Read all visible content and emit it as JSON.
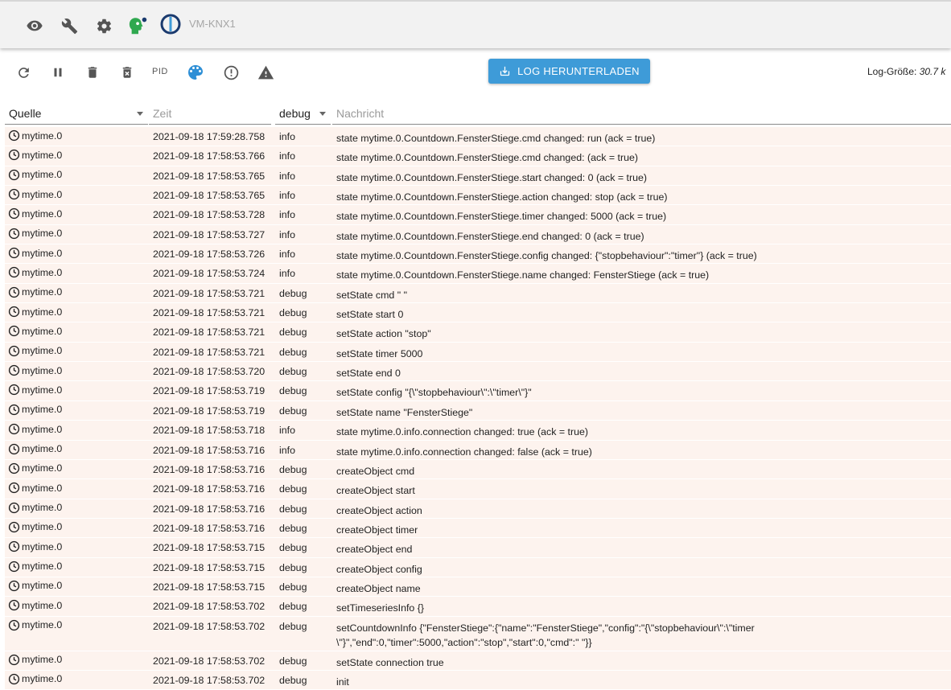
{
  "appbar": {
    "host": "VM-KNX1",
    "icons": [
      "eye-icon",
      "wrench-icon",
      "gear-icon",
      "admin-person-icon",
      "iobroker-logo-icon"
    ]
  },
  "toolbar": {
    "icons": [
      "refresh-icon",
      "pause-icon",
      "delete-icon",
      "delete-all-icon",
      "pid-label",
      "palette-icon",
      "error-circle-icon",
      "warning-triangle-icon"
    ],
    "pid_label": "PID",
    "download_label": "LOG HERUNTERLADEN",
    "logsize_label": "Log-Größe:",
    "logsize_value": "30.7 k"
  },
  "colors": {
    "accent": "#3e9bd8",
    "row_bg": "#fdf3ee",
    "admin_green": "#2fa84f",
    "admin_dot": "#1a3a6e"
  },
  "table": {
    "headers": {
      "source": "Quelle",
      "time": "Zeit",
      "severity": "debug",
      "message": "Nachricht"
    },
    "rows": [
      {
        "source": "mytime.0",
        "time": "2021-09-18 17:59:28.758",
        "severity": "info",
        "message": [
          "state mytime.0.Countdown.FensterStiege.cmd changed: run (ack = true)"
        ]
      },
      {
        "source": "mytime.0",
        "time": "2021-09-18 17:58:53.766",
        "severity": "info",
        "message": [
          "state mytime.0.Countdown.FensterStiege.cmd changed: (ack = true)"
        ]
      },
      {
        "source": "mytime.0",
        "time": "2021-09-18 17:58:53.765",
        "severity": "info",
        "message": [
          "state mytime.0.Countdown.FensterStiege.start changed: 0 (ack = true)"
        ]
      },
      {
        "source": "mytime.0",
        "time": "2021-09-18 17:58:53.765",
        "severity": "info",
        "message": [
          "state mytime.0.Countdown.FensterStiege.action changed: stop (ack = true)"
        ]
      },
      {
        "source": "mytime.0",
        "time": "2021-09-18 17:58:53.728",
        "severity": "info",
        "message": [
          "state mytime.0.Countdown.FensterStiege.timer changed: 5000 (ack = true)"
        ]
      },
      {
        "source": "mytime.0",
        "time": "2021-09-18 17:58:53.727",
        "severity": "info",
        "message": [
          "state mytime.0.Countdown.FensterStiege.end changed: 0 (ack = true)"
        ]
      },
      {
        "source": "mytime.0",
        "time": "2021-09-18 17:58:53.726",
        "severity": "info",
        "message": [
          "state mytime.0.Countdown.FensterStiege.config changed: {\"stopbehaviour\":\"timer\"} (ack = true)"
        ]
      },
      {
        "source": "mytime.0",
        "time": "2021-09-18 17:58:53.724",
        "severity": "info",
        "message": [
          "state mytime.0.Countdown.FensterStiege.name changed: FensterStiege (ack = true)"
        ]
      },
      {
        "source": "mytime.0",
        "time": "2021-09-18 17:58:53.721",
        "severity": "debug",
        "message": [
          "setState cmd \" \""
        ]
      },
      {
        "source": "mytime.0",
        "time": "2021-09-18 17:58:53.721",
        "severity": "debug",
        "message": [
          "setState start 0"
        ]
      },
      {
        "source": "mytime.0",
        "time": "2021-09-18 17:58:53.721",
        "severity": "debug",
        "message": [
          "setState action \"stop\""
        ]
      },
      {
        "source": "mytime.0",
        "time": "2021-09-18 17:58:53.721",
        "severity": "debug",
        "message": [
          "setState timer 5000"
        ]
      },
      {
        "source": "mytime.0",
        "time": "2021-09-18 17:58:53.720",
        "severity": "debug",
        "message": [
          "setState end 0"
        ]
      },
      {
        "source": "mytime.0",
        "time": "2021-09-18 17:58:53.719",
        "severity": "debug",
        "message": [
          "setState config \"{\\\"stopbehaviour\\\":\\\"timer\\\"}\""
        ]
      },
      {
        "source": "mytime.0",
        "time": "2021-09-18 17:58:53.719",
        "severity": "debug",
        "message": [
          "setState name \"FensterStiege\""
        ]
      },
      {
        "source": "mytime.0",
        "time": "2021-09-18 17:58:53.718",
        "severity": "info",
        "message": [
          "state mytime.0.info.connection changed: true (ack = true)"
        ]
      },
      {
        "source": "mytime.0",
        "time": "2021-09-18 17:58:53.716",
        "severity": "info",
        "message": [
          "state mytime.0.info.connection changed: false (ack = true)"
        ]
      },
      {
        "source": "mytime.0",
        "time": "2021-09-18 17:58:53.716",
        "severity": "debug",
        "message": [
          "createObject cmd"
        ]
      },
      {
        "source": "mytime.0",
        "time": "2021-09-18 17:58:53.716",
        "severity": "debug",
        "message": [
          "createObject start"
        ]
      },
      {
        "source": "mytime.0",
        "time": "2021-09-18 17:58:53.716",
        "severity": "debug",
        "message": [
          "createObject action"
        ]
      },
      {
        "source": "mytime.0",
        "time": "2021-09-18 17:58:53.716",
        "severity": "debug",
        "message": [
          "createObject timer"
        ]
      },
      {
        "source": "mytime.0",
        "time": "2021-09-18 17:58:53.715",
        "severity": "debug",
        "message": [
          "createObject end"
        ]
      },
      {
        "source": "mytime.0",
        "time": "2021-09-18 17:58:53.715",
        "severity": "debug",
        "message": [
          "createObject config"
        ]
      },
      {
        "source": "mytime.0",
        "time": "2021-09-18 17:58:53.715",
        "severity": "debug",
        "message": [
          "createObject name"
        ]
      },
      {
        "source": "mytime.0",
        "time": "2021-09-18 17:58:53.702",
        "severity": "debug",
        "message": [
          "setTimeseriesInfo {}"
        ]
      },
      {
        "source": "mytime.0",
        "time": "2021-09-18 17:58:53.702",
        "severity": "debug",
        "message": [
          "setCountdownInfo {\"FensterStiege\":{\"name\":\"FensterStiege\",\"config\":\"{\\\"stopbehaviour\\\":\\\"timer",
          "\\\"}\",\"end\":0,\"timer\":5000,\"action\":\"stop\",\"start\":0,\"cmd\":\" \"}}"
        ]
      },
      {
        "source": "mytime.0",
        "time": "2021-09-18 17:58:53.702",
        "severity": "debug",
        "message": [
          "setState connection true"
        ]
      },
      {
        "source": "mytime.0",
        "time": "2021-09-18 17:58:53.702",
        "severity": "debug",
        "message": [
          "init"
        ]
      }
    ]
  }
}
